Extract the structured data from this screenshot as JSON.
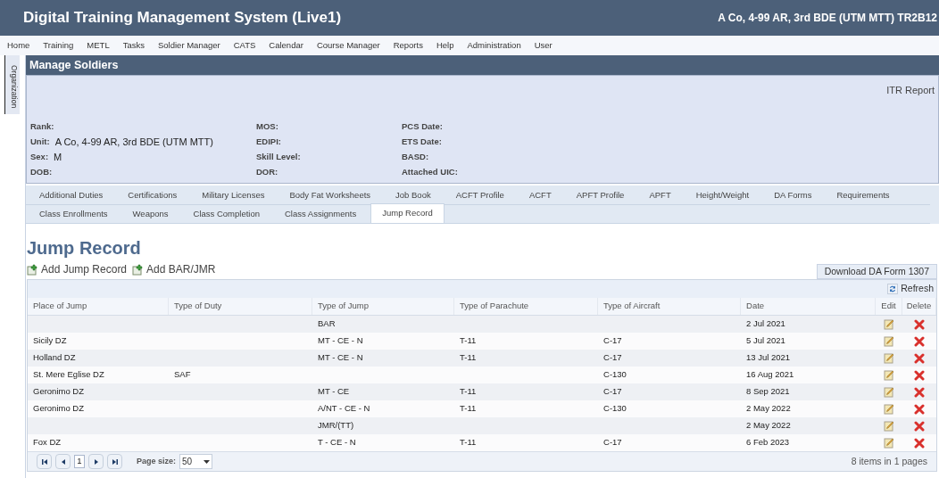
{
  "header": {
    "title": "Digital Training Management System (Live1)",
    "unit": "A Co, 4-99 AR, 3rd BDE (UTM MTT) TR2B12"
  },
  "menu": [
    "Home",
    "Training",
    "METL",
    "Tasks",
    "Soldier Manager",
    "CATS",
    "Calendar",
    "Course Manager",
    "Reports",
    "Help",
    "Administration",
    "User"
  ],
  "side_tab": "Organization",
  "panel_title": "Manage Soldiers",
  "itr_link": "ITR Report",
  "info_columns": [
    [
      {
        "label": "Rank:"
      },
      {
        "label": "Unit:",
        "value": "A Co, 4-99 AR, 3rd BDE (UTM MTT)"
      },
      {
        "label": "Sex:",
        "value": "M"
      },
      {
        "label": "DOB:"
      }
    ],
    [
      {
        "label": "MOS:"
      },
      {
        "label": "EDIPI:"
      },
      {
        "label": "Skill Level:"
      },
      {
        "label": "DOR:"
      }
    ],
    [
      {
        "label": "PCS Date:"
      },
      {
        "label": "ETS Date:"
      },
      {
        "label": "BASD:"
      },
      {
        "label": "Attached UIC:"
      }
    ]
  ],
  "tab_rows": [
    [
      {
        "label": "Additional Duties",
        "selected": false
      },
      {
        "label": "Certifications",
        "selected": false
      },
      {
        "label": "Military Licenses",
        "selected": false
      },
      {
        "label": "Body Fat Worksheets",
        "selected": false
      },
      {
        "label": "Job Book",
        "selected": false
      },
      {
        "label": "ACFT Profile",
        "selected": false
      },
      {
        "label": "ACFT",
        "selected": false
      },
      {
        "label": "APFT Profile",
        "selected": false
      },
      {
        "label": "APFT",
        "selected": false
      },
      {
        "label": "Height/Weight",
        "selected": false
      },
      {
        "label": "DA Forms",
        "selected": false
      },
      {
        "label": "Requirements",
        "selected": false
      }
    ],
    [
      {
        "label": "Class Enrollments",
        "selected": false
      },
      {
        "label": "Weapons",
        "selected": false
      },
      {
        "label": "Class Completion",
        "selected": false
      },
      {
        "label": "Class Assignments",
        "selected": false
      },
      {
        "label": "Jump Record",
        "selected": true
      }
    ]
  ],
  "section_title": "Jump Record",
  "actions": [
    "Add Jump Record",
    "Add BAR/JMR"
  ],
  "download_button": "Download DA Form 1307",
  "refresh_button": "Refresh",
  "table": {
    "columns": [
      "Place of Jump",
      "Type of Duty",
      "Type of Jump",
      "Type of Parachute",
      "Type of Aircraft",
      "Date",
      "Edit",
      "Delete"
    ],
    "rows": [
      [
        "",
        "",
        "BAR",
        "",
        "",
        "2 Jul 2021"
      ],
      [
        "Sicily DZ",
        "",
        "MT - CE - N",
        "T-11",
        "C-17",
        "5 Jul 2021"
      ],
      [
        "Holland DZ",
        "",
        "MT - CE - N",
        "T-11",
        "C-17",
        "13 Jul 2021"
      ],
      [
        "St. Mere Eglise DZ",
        "SAF",
        "",
        "",
        "C-130",
        "16 Aug 2021"
      ],
      [
        "Geronimo DZ",
        "",
        "MT - CE",
        "T-11",
        "C-17",
        "8 Sep 2021"
      ],
      [
        "Geronimo DZ",
        "",
        "A/NT - CE - N",
        "T-11",
        "C-130",
        "2 May 2022"
      ],
      [
        "",
        "",
        "JMR/(TT)",
        "",
        "",
        "2 May 2022"
      ],
      [
        "Fox DZ",
        "",
        "T - CE - N",
        "T-11",
        "C-17",
        "6 Feb 2023"
      ]
    ]
  },
  "pager": {
    "current_page": "1",
    "page_size_label": "Page size:",
    "page_size": "50",
    "summary": "8 items in 1 pages"
  }
}
